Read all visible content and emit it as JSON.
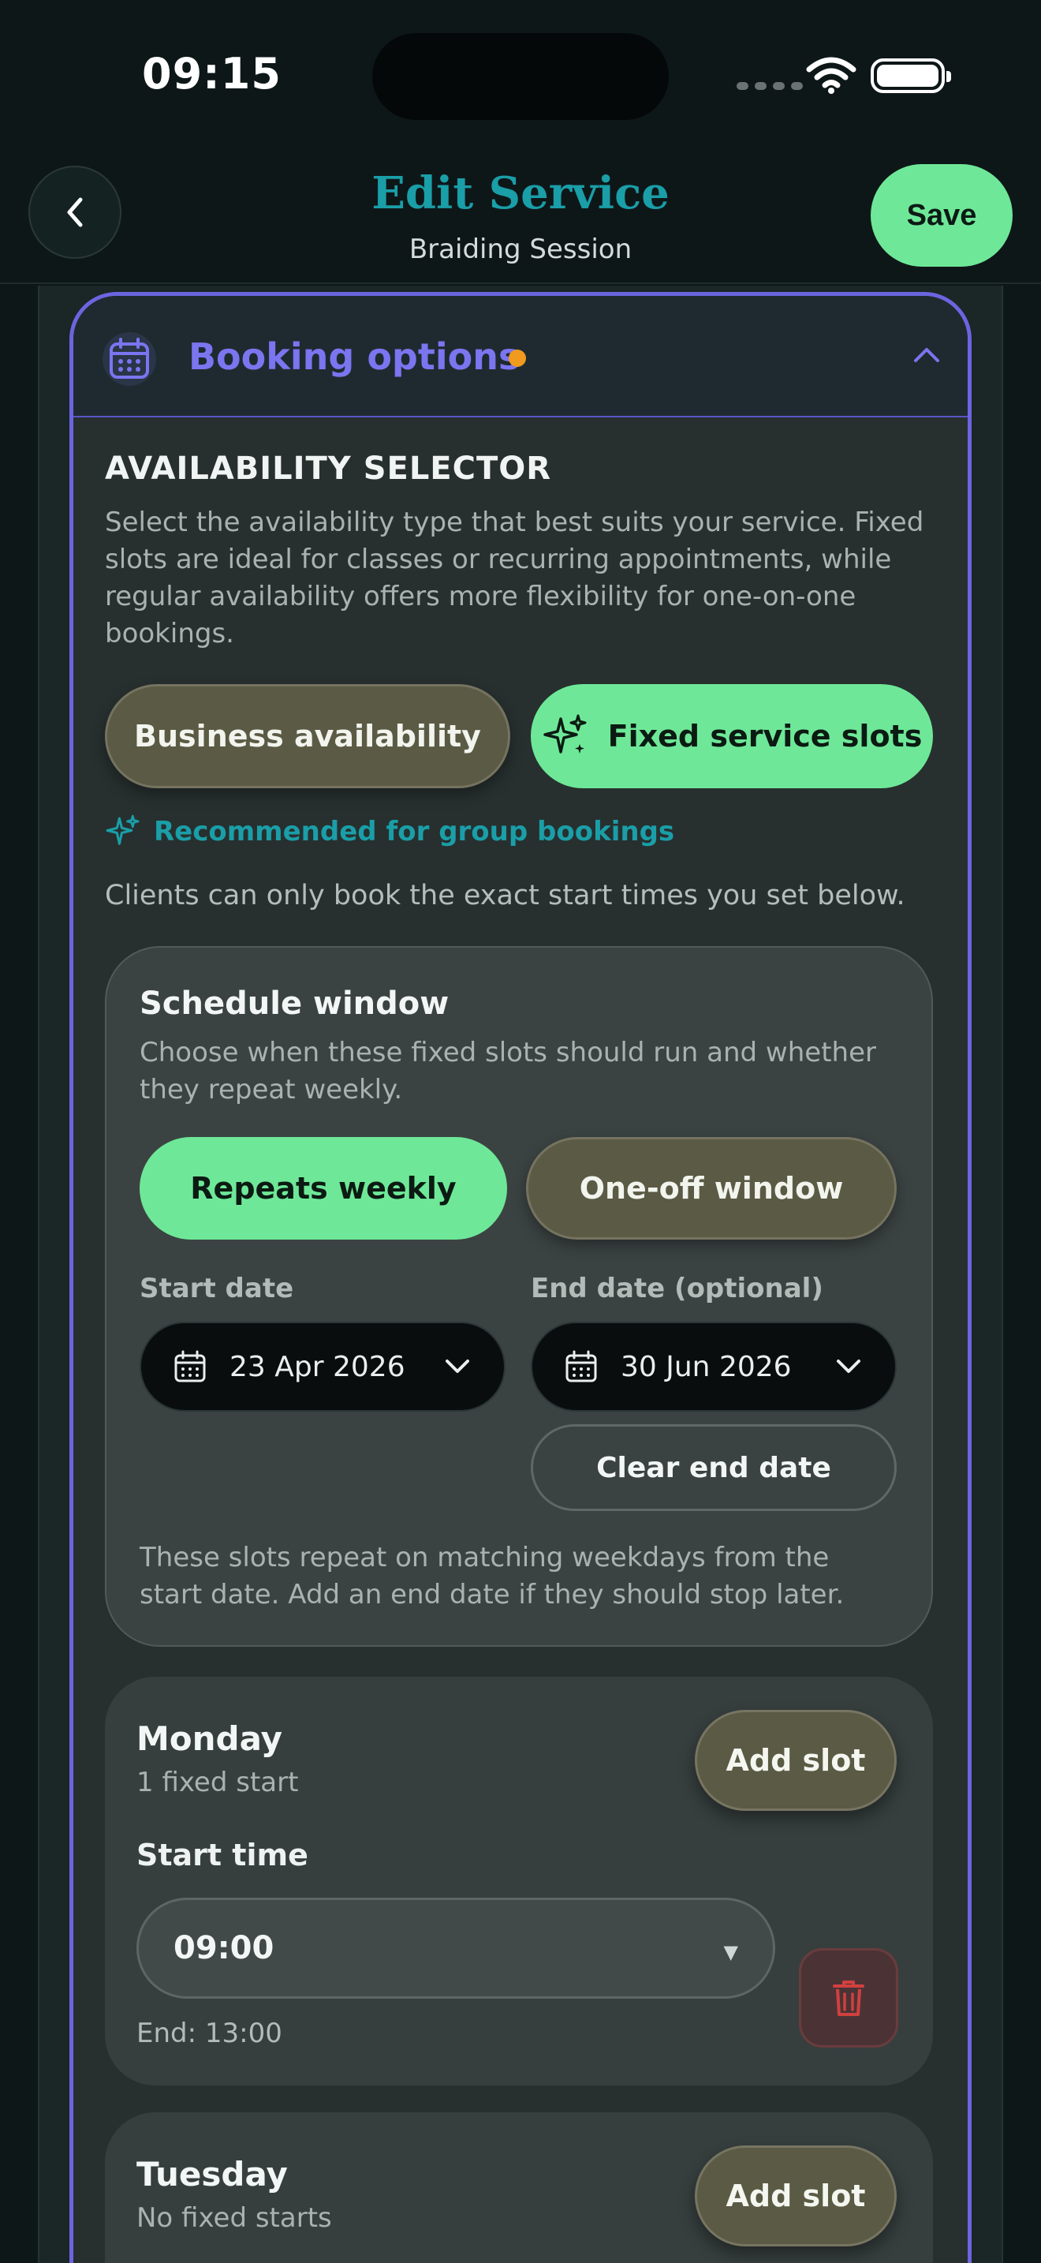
{
  "status_bar": {
    "time": "09:15"
  },
  "header": {
    "title": "Edit Service",
    "subtitle": "Braiding Session",
    "save_label": "Save"
  },
  "booking_options": {
    "title": "Booking options",
    "section_title": "AVAILABILITY SELECTOR",
    "description": "Select the availability type that best suits your service. Fixed slots are ideal for classes or recurring appointments, while regular availability offers more flexibility for one-on-one bookings.",
    "options": [
      {
        "label": "Business availability",
        "selected": false
      },
      {
        "label": "Fixed service slots",
        "selected": true
      }
    ],
    "recommendation": "Recommended for group bookings",
    "clients_note": "Clients can only book the exact start times you set below."
  },
  "schedule_window": {
    "title": "Schedule window",
    "description": "Choose when these fixed slots should run and whether they repeat weekly.",
    "modes": [
      {
        "label": "Repeats weekly",
        "selected": true
      },
      {
        "label": "One-off window",
        "selected": false
      }
    ],
    "start_label": "Start date",
    "start_value": "23 Apr 2026",
    "end_label": "End date (optional)",
    "end_value": "30 Jun 2026",
    "clear_label": "Clear end date",
    "footnote": "These slots repeat on matching weekdays from the start date. Add an end date if they should stop later."
  },
  "days": [
    {
      "name": "Monday",
      "summary": "1 fixed start",
      "add_label": "Add slot",
      "start_label": "Start time",
      "start_value": "09:00",
      "end_text": "End: 13:00"
    },
    {
      "name": "Tuesday",
      "summary": "No fixed starts",
      "add_label": "Add slot"
    }
  ],
  "colors": {
    "accent_purple": "#6b65e0",
    "primary_green": "#6ee898",
    "teal": "#1a9ea8",
    "status_dot": "#f09a1e",
    "danger": "#c0393b"
  }
}
